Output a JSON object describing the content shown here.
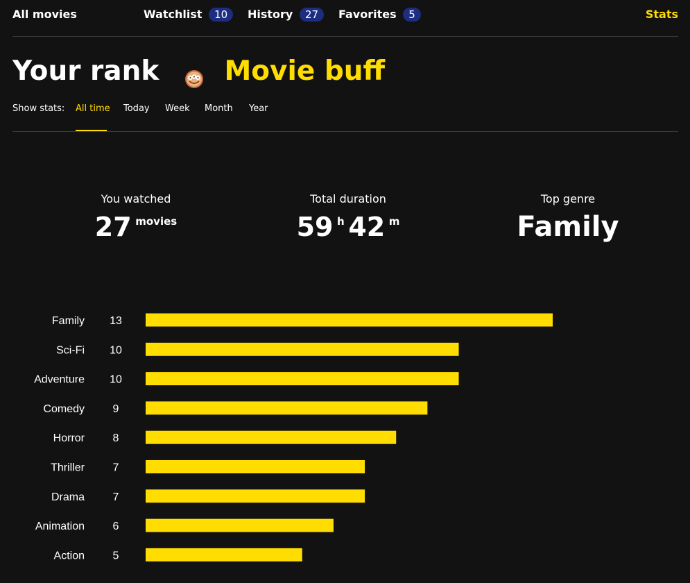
{
  "nav": {
    "all_movies": "All movies",
    "watchlist": {
      "label": "Watchlist",
      "count": "10"
    },
    "history": {
      "label": "History",
      "count": "27"
    },
    "favorites": {
      "label": "Favorites",
      "count": "5"
    },
    "stats": "Stats"
  },
  "rank": {
    "title": "Your rank",
    "avatar_icon": "rank-badge-icon",
    "name": "Movie buff"
  },
  "period": {
    "label": "Show stats:",
    "tabs": [
      "All time",
      "Today",
      "Week",
      "Month",
      "Year"
    ],
    "active": "All time"
  },
  "summary": {
    "watched": {
      "label": "You watched",
      "value": "27",
      "unit": "movies"
    },
    "duration": {
      "label": "Total duration",
      "hours": "59",
      "hours_unit": "h",
      "minutes": "42",
      "minutes_unit": "m"
    },
    "top_genre": {
      "label": "Top genre",
      "value": "Family"
    }
  },
  "colors": {
    "accent": "#ffdd00",
    "background": "#121212",
    "badge": "#1d2d80",
    "text": "#ffffff"
  },
  "chart_data": {
    "type": "bar",
    "orientation": "horizontal",
    "categories": [
      "Family",
      "Sci-Fi",
      "Adventure",
      "Comedy",
      "Horror",
      "Thriller",
      "Drama",
      "Animation",
      "Action"
    ],
    "values": [
      13,
      10,
      10,
      9,
      8,
      7,
      7,
      6,
      5
    ],
    "bar_color": "#ffdd00",
    "grid": false,
    "xlim": [
      0,
      13
    ]
  }
}
